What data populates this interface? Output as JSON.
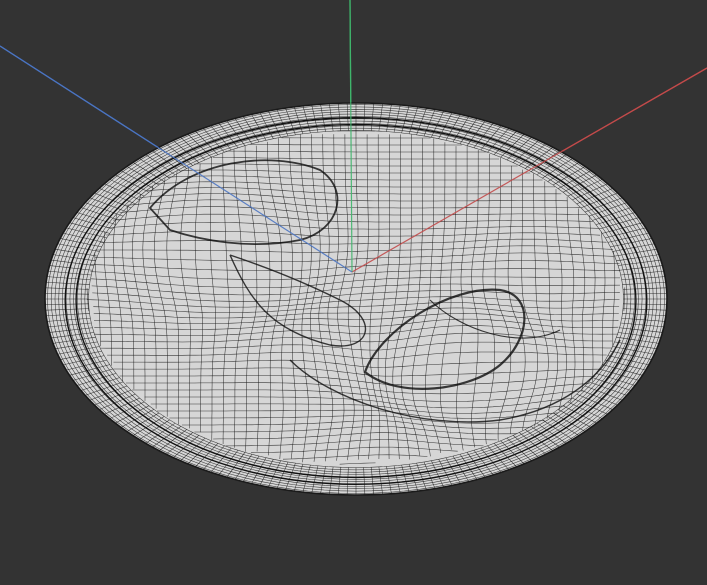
{
  "viewport": {
    "background": "#333333",
    "mesh_fill": "#d6d6d6",
    "mesh_line": "#1a1a1a"
  },
  "axes": [
    {
      "name": "x-axis",
      "color": "#c24a4a"
    },
    {
      "name": "y-axis",
      "color": "#3fb56b"
    },
    {
      "name": "z-axis",
      "color": "#4a74c2"
    }
  ],
  "model": {
    "type": "wireframe-dish",
    "features": [
      "outer-rim",
      "raised-lobe-left",
      "oval-depression-right",
      "channel-lower"
    ]
  }
}
